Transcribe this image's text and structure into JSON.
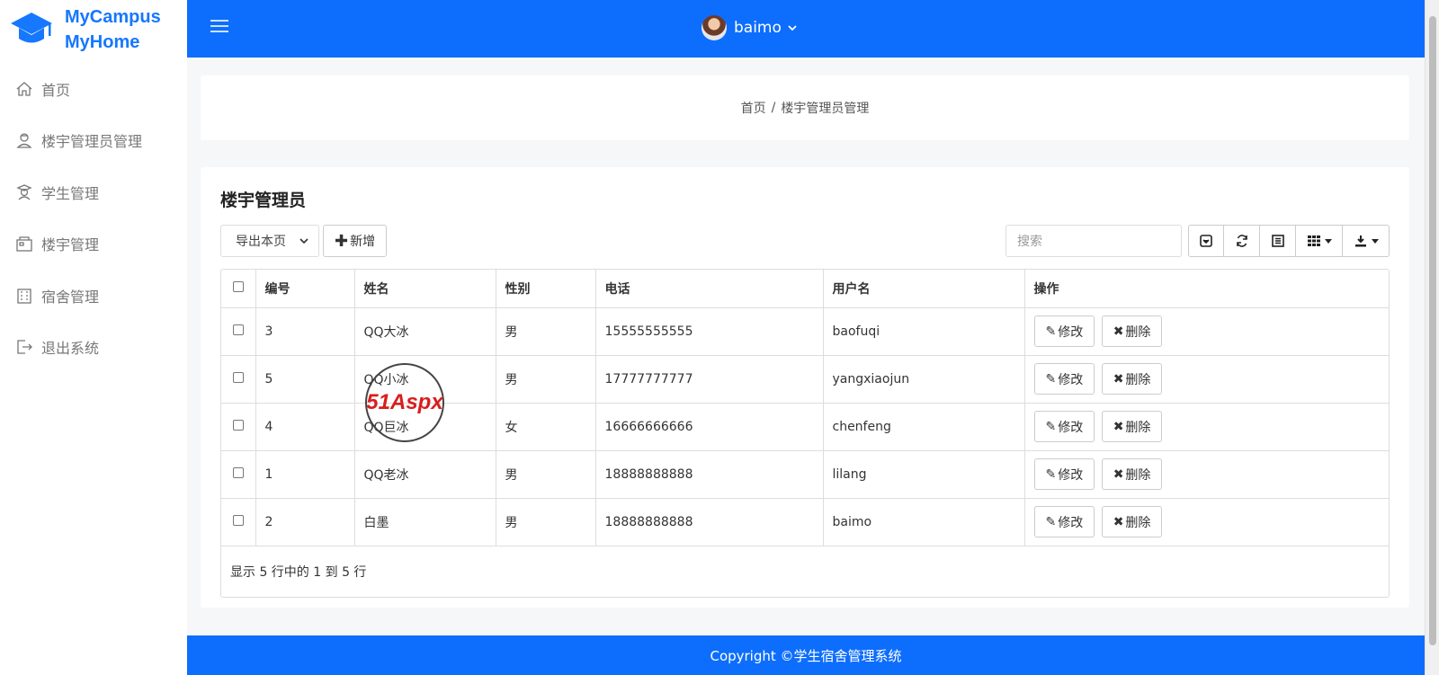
{
  "brand": {
    "line1": "MyCampus",
    "line2": "MyHome"
  },
  "sidebar": {
    "items": [
      {
        "label": "首页",
        "icon": "home-icon"
      },
      {
        "label": "楼宇管理员管理",
        "icon": "admin-icon"
      },
      {
        "label": "学生管理",
        "icon": "student-icon"
      },
      {
        "label": "楼宇管理",
        "icon": "building-icon"
      },
      {
        "label": "宿舍管理",
        "icon": "dorm-icon"
      },
      {
        "label": "退出系统",
        "icon": "logout-icon"
      }
    ]
  },
  "header": {
    "username": "baimo"
  },
  "breadcrumb": {
    "home": "首页",
    "separator": "/",
    "current": "楼宇管理员管理"
  },
  "main": {
    "title": "楼宇管理员",
    "export_select": "导出本页",
    "add_button": "新增",
    "search_placeholder": "搜索",
    "columns": [
      "编号",
      "姓名",
      "性别",
      "电话",
      "用户名",
      "操作"
    ],
    "rows": [
      {
        "id": "3",
        "name": "QQ大冰",
        "gender": "男",
        "phone": "15555555555",
        "username": "baofuqi"
      },
      {
        "id": "5",
        "name": "QQ小冰",
        "gender": "男",
        "phone": "17777777777",
        "username": "yangxiaojun"
      },
      {
        "id": "4",
        "name": "QQ巨冰",
        "gender": "女",
        "phone": "16666666666",
        "username": "chenfeng"
      },
      {
        "id": "1",
        "name": "QQ老冰",
        "gender": "男",
        "phone": "18888888888",
        "username": "lilang"
      },
      {
        "id": "2",
        "name": "白墨",
        "gender": "男",
        "phone": "18888888888",
        "username": "baimo"
      }
    ],
    "edit_label": "修改",
    "delete_label": "删除",
    "pagination_text": "显示 5 行中的 1 到 5 行"
  },
  "watermark": {
    "text": "51Aspx"
  },
  "footer": {
    "copyright": "Copyright ©学生宿舍管理系统"
  },
  "colors": {
    "primary": "#0d6efd",
    "brand": "#1677ff"
  }
}
